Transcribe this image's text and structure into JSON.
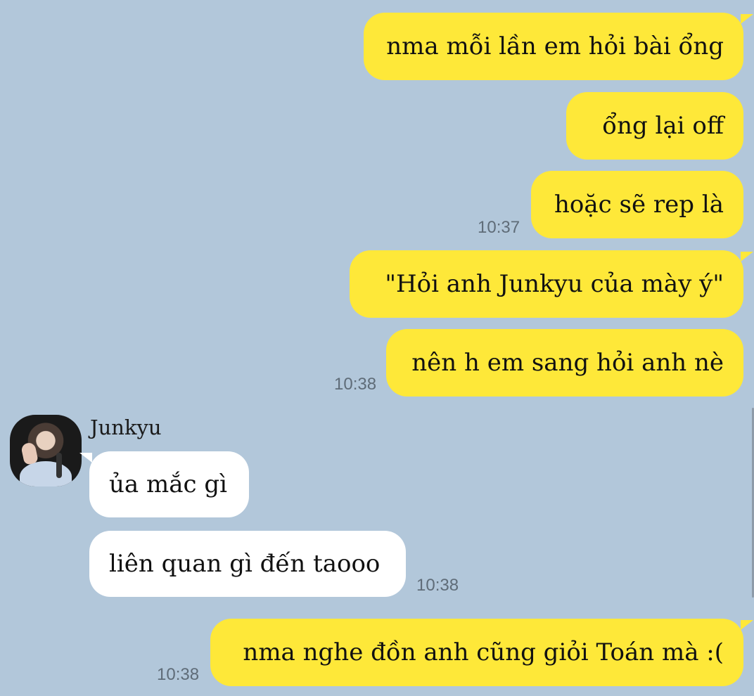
{
  "messages": {
    "m1": {
      "text": "nma mỗi lần em hỏi bài ổng",
      "direction": "out"
    },
    "m2": {
      "text": "ổng lại off",
      "direction": "out"
    },
    "m3": {
      "text": "hoặc sẽ rep là",
      "direction": "out",
      "time": "10:37"
    },
    "m4": {
      "text": "\"Hỏi anh Junkyu của mày ý\"",
      "direction": "out"
    },
    "m5": {
      "text": "nên h em sang hỏi anh nè",
      "direction": "out",
      "time": "10:38"
    },
    "m6": {
      "text": "ủa mắc gì",
      "direction": "in"
    },
    "m7": {
      "text": "liên quan gì đến taooo",
      "direction": "in",
      "time": "10:38"
    },
    "m8": {
      "text": "nma nghe đồn anh cũng giỏi Toán mà :(",
      "direction": "out",
      "time": "10:38"
    }
  },
  "contact": {
    "name": "Junkyu",
    "avatar_icon": "profile-photo"
  },
  "colors": {
    "background": "#b2c7da",
    "outgoing_bubble": "#fee839",
    "incoming_bubble": "#ffffff",
    "timestamp": "#5f6c78"
  }
}
